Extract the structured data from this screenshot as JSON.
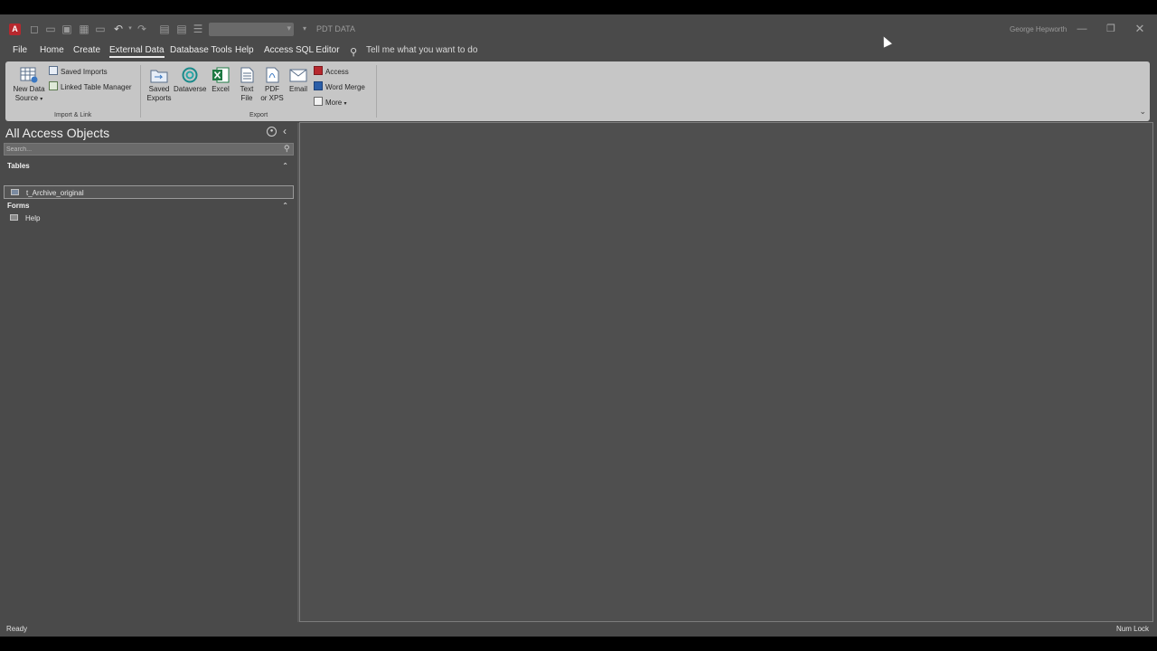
{
  "titlebar": {
    "app_icon_label": "A",
    "title": "PDT DATA",
    "user": "George Hepworth",
    "minimize_icon": "minimize-icon",
    "restore_icon": "restore-icon",
    "close_icon": "close-icon"
  },
  "menu": {
    "tabs": [
      {
        "label": "File"
      },
      {
        "label": "Home"
      },
      {
        "label": "Create"
      },
      {
        "label": "External Data",
        "active": true
      },
      {
        "label": "Database Tools"
      },
      {
        "label": "Help"
      },
      {
        "label": "Access SQL Editor"
      }
    ],
    "tell_me": "Tell me what you want to do"
  },
  "ribbon": {
    "import_link": {
      "new_data_source_line1": "New Data",
      "new_data_source_line2": "Source",
      "saved_imports": "Saved Imports",
      "linked_table_manager": "Linked Table Manager",
      "group_label": "Import & Link"
    },
    "export": {
      "saved_exports_line1": "Saved",
      "saved_exports_line2": "Exports",
      "dataverse": "Dataverse",
      "excel": "Excel",
      "text_file_line1": "Text",
      "text_file_line2": "File",
      "pdf_line1": "PDF",
      "pdf_line2": "or XPS",
      "email": "Email",
      "access": "Access",
      "word_merge": "Word Merge",
      "more": "More",
      "group_label": "Export"
    }
  },
  "nav": {
    "title": "All Access Objects",
    "search_placeholder": "Search...",
    "sections": [
      {
        "header": "Tables",
        "items": [
          "t_Archive_original"
        ]
      },
      {
        "header": "Forms",
        "items": [
          "Help"
        ]
      }
    ]
  },
  "status": {
    "left": "Ready",
    "right": "Num Lock"
  },
  "colors": {
    "background": "#4a4a4a",
    "ribbon": "#c6c6c6",
    "accent": "#1e5fa8",
    "app_icon": "#b7282e"
  }
}
